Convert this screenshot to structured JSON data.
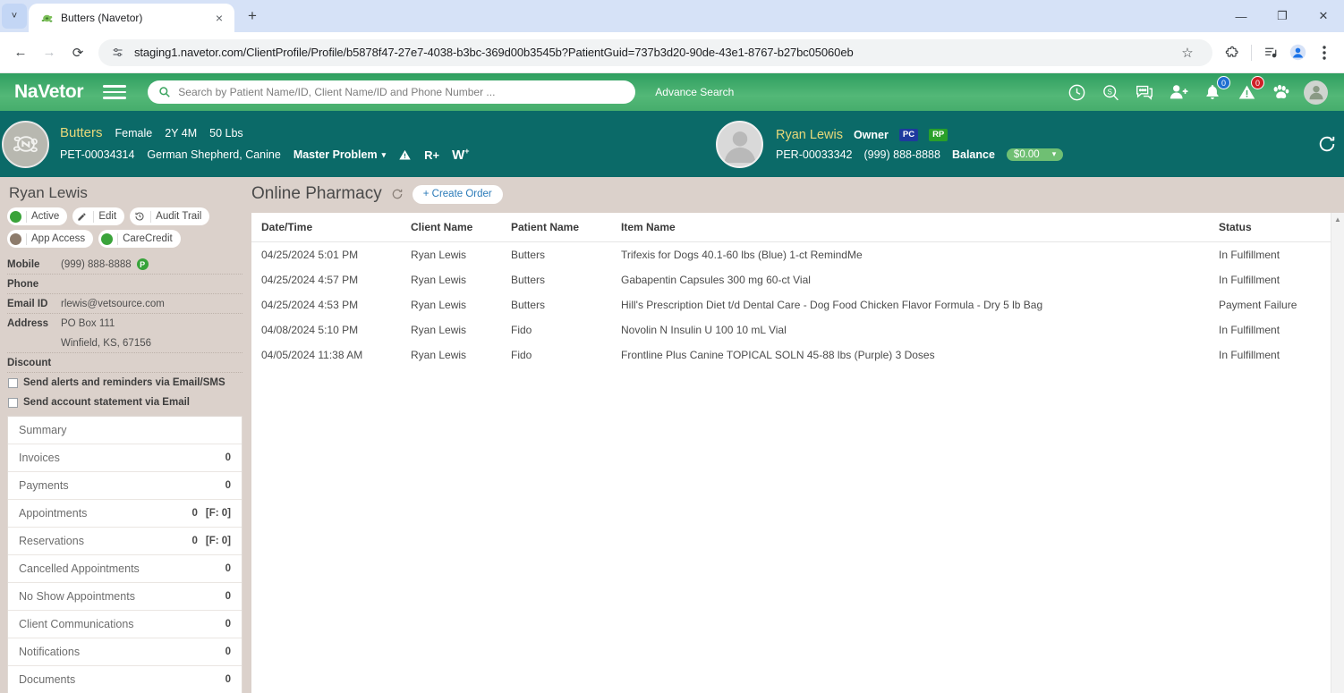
{
  "browser": {
    "tab": {
      "title": "Butters (Navetor)",
      "favicon": "turtle-favicon",
      "close_label": "×"
    },
    "new_tab_label": "+",
    "tablist_label": "˅",
    "window": {
      "minimize": "—",
      "maximize": "❐",
      "close": "✕"
    },
    "nav": {
      "back": "←",
      "forward": "→",
      "reload": "⟳"
    },
    "omnibox": {
      "url": "staging1.navetor.com/ClientProfile/Profile/b5878f47-27e7-4038-b3bc-369d00b3545b?PatientGuid=737b3d20-90de-43e1-8767-b27bc05060eb",
      "site_info_icon": "tune-icon",
      "star_icon": "☆"
    },
    "toolbar_icons": [
      "extensions-puzzle-icon",
      "media-playlist-icon",
      "profile-avatar-icon",
      "three-dot-menu-icon"
    ]
  },
  "appbar": {
    "brand": "NaVetor",
    "menu_icon": "hamburger-icon",
    "search": {
      "placeholder": "Search by Patient Name/ID, Client Name/ID and Phone Number ...",
      "icon": "search-icon"
    },
    "advance_search": "Advance Search",
    "icons": [
      {
        "name": "clock-icon",
        "badge": null
      },
      {
        "name": "dollar-search-icon",
        "badge": null
      },
      {
        "name": "chat-icon",
        "badge": null
      },
      {
        "name": "add-user-icon",
        "badge": null
      },
      {
        "name": "bell-icon",
        "badge": "0",
        "badge_color": "#1f6fd0"
      },
      {
        "name": "alert-triangle-icon",
        "badge": "0",
        "badge_color": "#cf2027"
      },
      {
        "name": "paw-icon",
        "badge": null
      }
    ],
    "user_avatar": "user-avatar-icon"
  },
  "patient_header": {
    "avatar_icon": "pet-turtle-avatar",
    "name": "Butters",
    "sex": "Female",
    "age": "2Y 4M",
    "weight": "50 Lbs",
    "pet_id": "PET-00034314",
    "breed": "German Shepherd, Canine",
    "master_problem": "Master Problem",
    "master_problem_caret": "▾",
    "alert_icon": "warning-triangle-icon",
    "rplus_label": "R+",
    "w_label": "W",
    "w_plus": "+",
    "refresh_icon": "refresh-icon",
    "owner": {
      "avatar_icon": "owner-avatar-icon",
      "name": "Ryan Lewis",
      "role": "Owner",
      "tags": [
        {
          "label": "PC",
          "color": "#1e3a9e"
        },
        {
          "label": "RP",
          "color": "#2aa02a"
        }
      ],
      "person_id": "PER-00033342",
      "phone": "(999) 888-8888",
      "balance_label": "Balance",
      "balance_value": "$0.00",
      "balance_caret": "▾"
    }
  },
  "sidebar": {
    "title": "Ryan Lewis",
    "chips_row1": [
      {
        "label": "Active",
        "dot": "#3aa33a",
        "icon": null
      },
      {
        "label": "Edit",
        "dot": null,
        "icon": "pencil-icon"
      },
      {
        "label": "Audit Trail",
        "dot": null,
        "icon": "history-icon"
      }
    ],
    "chips_row2": [
      {
        "label": "App Access",
        "dot": "#8d7b6b",
        "icon": null
      },
      {
        "label": "CareCredit",
        "dot": "#3aa33a",
        "icon": null
      }
    ],
    "fields": [
      {
        "key": "Mobile",
        "value": "(999) 888-8888",
        "badge": "P"
      },
      {
        "key": "Phone",
        "value": ""
      },
      {
        "key": "Email ID",
        "value": "rlewis@vetsource.com"
      },
      {
        "key": "Address",
        "value": "PO Box 111",
        "value2": "Winfield, KS, 67156"
      },
      {
        "key": "Discount",
        "value": ""
      }
    ],
    "checkboxes": [
      {
        "label": "Send alerts and reminders via Email/SMS",
        "checked": false
      },
      {
        "label": "Send account statement via Email",
        "checked": false
      }
    ],
    "nav_items": [
      {
        "label": "Summary",
        "count": ""
      },
      {
        "label": "Invoices",
        "count": "0"
      },
      {
        "label": "Payments",
        "count": "0"
      },
      {
        "label": "Appointments",
        "count": "0",
        "count2": "[F: 0]"
      },
      {
        "label": "Reservations",
        "count": "0",
        "count2": "[F: 0]"
      },
      {
        "label": "Cancelled Appointments",
        "count": "0"
      },
      {
        "label": "No Show Appointments",
        "count": "0"
      },
      {
        "label": "Client Communications",
        "count": "0"
      },
      {
        "label": "Notifications",
        "count": "0"
      },
      {
        "label": "Documents",
        "count": "0"
      }
    ]
  },
  "main": {
    "title": "Online Pharmacy",
    "refresh_icon": "refresh-icon",
    "create_order_label": "+ Create Order",
    "columns": [
      "Date/Time",
      "Client Name",
      "Patient Name",
      "Item Name",
      "Status"
    ],
    "rows": [
      {
        "datetime": "04/25/2024 5:01 PM",
        "client": "Ryan Lewis",
        "patient": "Butters",
        "item": "Trifexis for Dogs 40.1-60 lbs (Blue) 1-ct RemindMe",
        "status": "In Fulfillment"
      },
      {
        "datetime": "04/25/2024 4:57 PM",
        "client": "Ryan Lewis",
        "patient": "Butters",
        "item": "Gabapentin Capsules 300 mg 60-ct Vial",
        "status": "In Fulfillment"
      },
      {
        "datetime": "04/25/2024 4:53 PM",
        "client": "Ryan Lewis",
        "patient": "Butters",
        "item": "Hill's Prescription Diet t/d Dental Care - Dog Food Chicken Flavor Formula - Dry 5 lb Bag",
        "status": "Payment Failure"
      },
      {
        "datetime": "04/08/2024 5:10 PM",
        "client": "Ryan Lewis",
        "patient": "Fido",
        "item": "Novolin N Insulin U 100 10 mL Vial",
        "status": "In Fulfillment"
      },
      {
        "datetime": "04/05/2024 11:38 AM",
        "client": "Ryan Lewis",
        "patient": "Fido",
        "item": "Frontline Plus Canine TOPICAL SOLN 45-88 lbs (Purple) 3 Doses",
        "status": "In Fulfillment"
      }
    ],
    "scroll_up_arrow": "▲"
  },
  "colors": {
    "app_green": "#46ad6c",
    "teal": "#0b6a68",
    "page_bg": "#dbd1cb",
    "accent_yellow": "#e8d87a",
    "link_blue": "#2b7bb9"
  }
}
